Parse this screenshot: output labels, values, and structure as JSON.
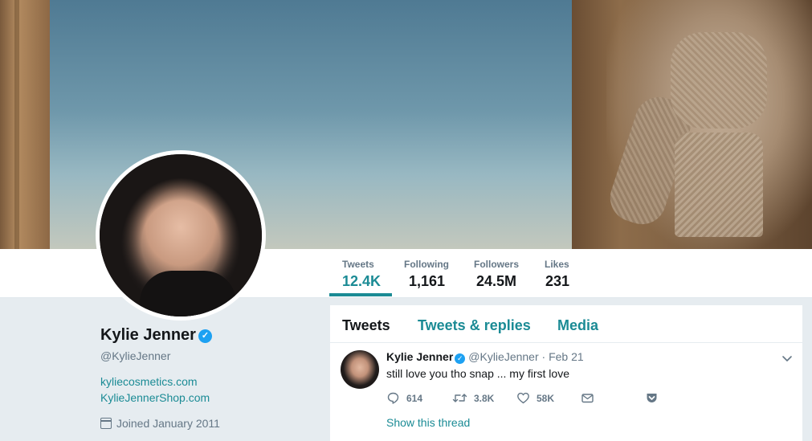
{
  "profile": {
    "name": "Kylie Jenner",
    "handle": "@KylieJenner",
    "links": [
      "kyliecosmetics.com",
      "KylieJennerShop.com"
    ],
    "joined": "Joined January 2011"
  },
  "stats": [
    {
      "label": "Tweets",
      "value": "12.4K"
    },
    {
      "label": "Following",
      "value": "1,161"
    },
    {
      "label": "Followers",
      "value": "24.5M"
    },
    {
      "label": "Likes",
      "value": "231"
    }
  ],
  "tabs": [
    "Tweets",
    "Tweets & replies",
    "Media"
  ],
  "tweet": {
    "name": "Kylie Jenner",
    "handle": "@KylieJenner",
    "date": "· Feb 21",
    "text": "still love you tho snap ... my first love",
    "replies": "614",
    "retweets": "3.8K",
    "likes": "58K",
    "show_thread": "Show this thread"
  },
  "colors": {
    "accent": "#1b8b95",
    "verified": "#1da1f2",
    "muted": "#657786",
    "background": "#e6ecf0"
  },
  "icons": [
    "verified-badge-icon",
    "calendar-icon",
    "chevron-down-icon",
    "reply-icon",
    "retweet-icon",
    "like-icon",
    "direct-message-icon",
    "pocket-icon"
  ]
}
